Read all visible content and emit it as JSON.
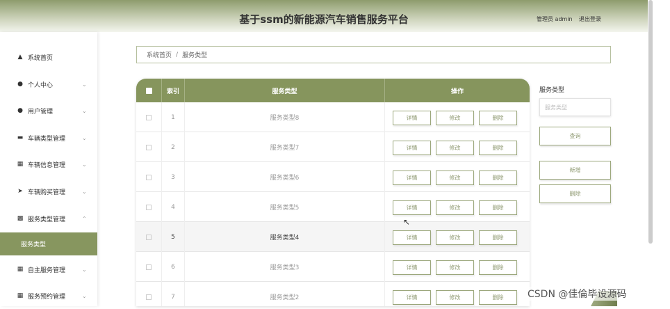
{
  "header": {
    "title": "基于ssm的新能源汽车销售服务平台",
    "user": "管理员 admin",
    "logout": "退出登录"
  },
  "sidebar": {
    "items": [
      {
        "label": "系统首页",
        "icon": "home-icon",
        "chevron": false
      },
      {
        "label": "个人中心",
        "icon": "person-icon",
        "chevron": true
      },
      {
        "label": "用户管理",
        "icon": "user-icon",
        "chevron": true
      },
      {
        "label": "车辆类型管理",
        "icon": "card-icon",
        "chevron": true
      },
      {
        "label": "车辆信息管理",
        "icon": "grid-icon",
        "chevron": true
      },
      {
        "label": "车辆购买管理",
        "icon": "send-icon",
        "chevron": true
      },
      {
        "label": "服务类型管理",
        "icon": "clipboard-icon",
        "chevron": true
      },
      {
        "label": "自主服务管理",
        "icon": "grid-icon",
        "chevron": true
      },
      {
        "label": "服务预约管理",
        "icon": "table-icon",
        "chevron": true
      }
    ],
    "active_sub": "服务类型"
  },
  "breadcrumb": {
    "home": "系统首页",
    "sep": "/",
    "current": "服务类型"
  },
  "table": {
    "headers": {
      "index": "索引",
      "type": "服务类型",
      "ops": "操作"
    },
    "rows": [
      {
        "index": "1",
        "type": "服务类型8"
      },
      {
        "index": "2",
        "type": "服务类型7"
      },
      {
        "index": "3",
        "type": "服务类型6"
      },
      {
        "index": "4",
        "type": "服务类型5"
      },
      {
        "index": "5",
        "type": "服务类型4"
      },
      {
        "index": "6",
        "type": "服务类型3"
      },
      {
        "index": "7",
        "type": "服务类型2"
      }
    ],
    "buttons": {
      "detail": "详情",
      "edit": "修改",
      "delete": "删除"
    }
  },
  "search": {
    "label": "服务类型",
    "placeholder": "服务类型",
    "query": "查询",
    "add": "新增",
    "delete": "删除"
  },
  "watermark": "CSDN @佳倫毕设源码",
  "colors": {
    "accent": "#86955d"
  }
}
